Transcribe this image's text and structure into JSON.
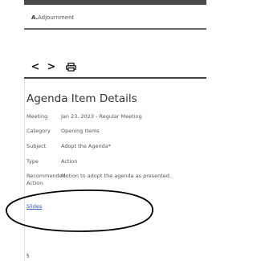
{
  "agenda_item": {
    "letter": "A.",
    "title": "Adjournment"
  },
  "toolbar": {
    "prev_label": "<",
    "next_label": ">"
  },
  "details": {
    "heading": "Agenda Item Details",
    "meeting": {
      "label": "Meeting",
      "value": "Jan 23, 2023 - Regular Meeting"
    },
    "category": {
      "label": "Category",
      "value": "Opening Items"
    },
    "subject": {
      "label": "Subject",
      "value": "Adopt the Agenda*"
    },
    "type": {
      "label": "Type",
      "value": "Action"
    },
    "recommended_action": {
      "label_line1": "Recommended",
      "label_line2": "Action",
      "value": "Motion to adopt the agenda as presented."
    }
  },
  "attachments": {
    "link": "Slides"
  },
  "footer": {
    "section_mark": "§"
  },
  "colors": {
    "link": "#2a57c9",
    "bar": "#4a4a4a"
  },
  "icons": {
    "print": "printer-icon",
    "highlight": "hand-drawn-oval"
  }
}
